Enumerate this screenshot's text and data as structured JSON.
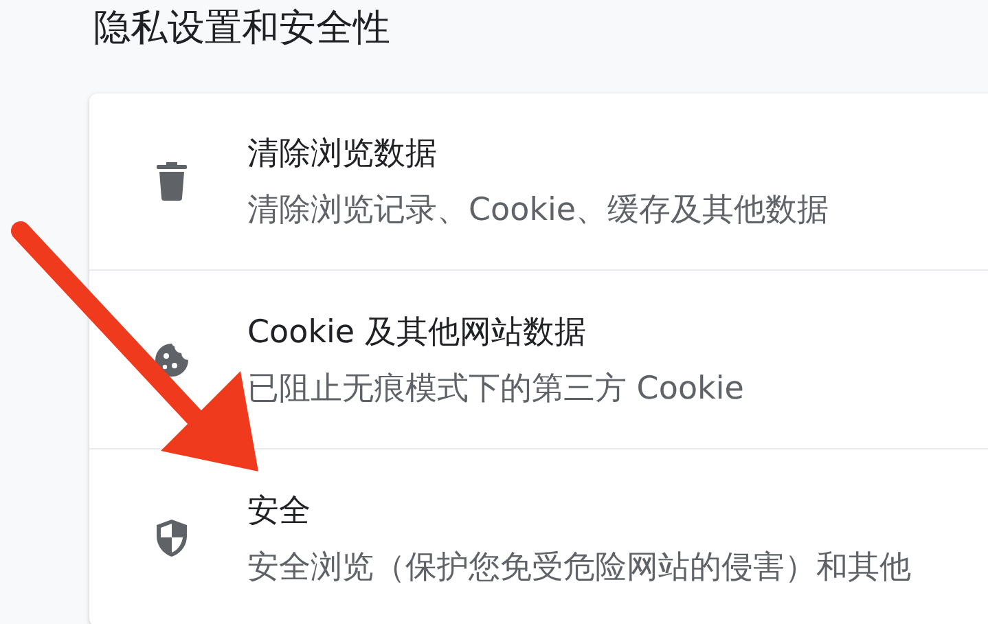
{
  "section_title": "隐私设置和安全性",
  "items": [
    {
      "kind": "trash",
      "title": "清除浏览数据",
      "subtitle": "清除浏览记录、Cookie、缓存及其他数据"
    },
    {
      "kind": "cookie",
      "title": "Cookie 及其他网站数据",
      "subtitle": "已阻止无痕模式下的第三方 Cookie"
    },
    {
      "kind": "shield",
      "title": "安全",
      "subtitle": "安全浏览（保护您免受危险网站的侵害）和其他"
    }
  ]
}
